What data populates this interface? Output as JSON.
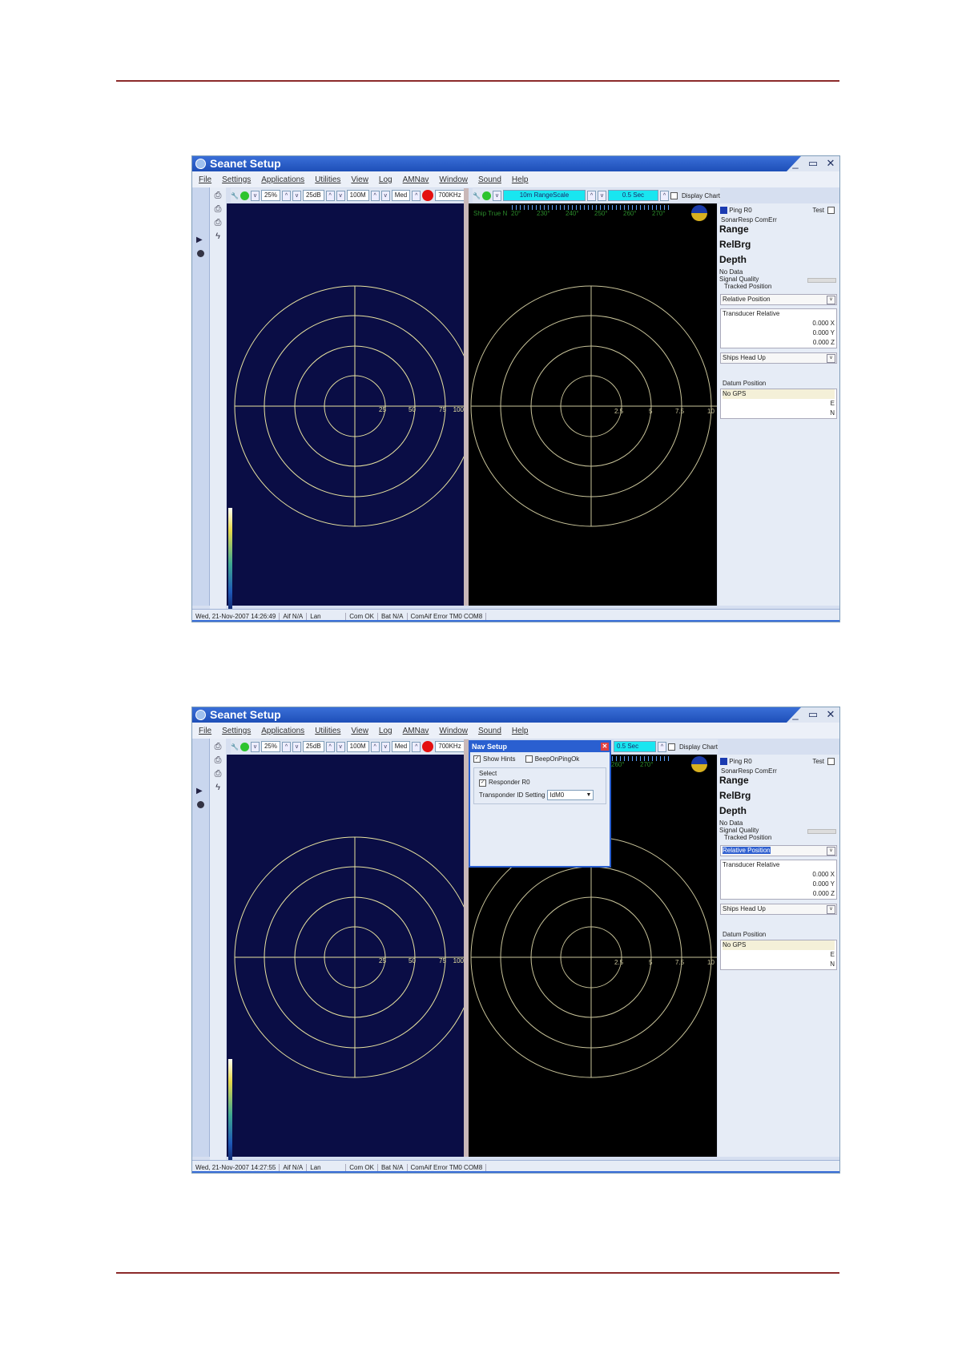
{
  "app_title": "Seanet Setup",
  "menu": [
    "File",
    "Settings",
    "Applications",
    "Utilities",
    "View",
    "Log",
    "AMNav",
    "Window",
    "Sound",
    "Help"
  ],
  "window_controls": [
    "_",
    "▭",
    "✕"
  ],
  "left_toolbar": {
    "gain_pct": "25%",
    "contrast": "25dB",
    "range": "100M",
    "resolution": "Med",
    "frequency": "700KHz"
  },
  "right_toolbar": {
    "range_scale": "10m RangeScale",
    "interval": "0.5 Sec",
    "display_chart": "Display Chart"
  },
  "heading_bar": {
    "label": "Ship True N",
    "bearings": [
      "20°",
      "230°",
      "240°",
      "250°",
      "260°",
      "270°"
    ]
  },
  "left_ring_labels": [
    "25",
    "50",
    "75",
    "100"
  ],
  "right_ring_labels": [
    "2.5",
    "5",
    "7.5",
    "10"
  ],
  "side": {
    "ping": "Ping R0",
    "test": "Test",
    "sonar_resp": "SonarResp ComErr",
    "range": "Range",
    "relbrg": "RelBrg",
    "depth": "Depth",
    "no_data": "No Data",
    "signal_quality": "Signal Quality",
    "tracked_position": "Tracked Position",
    "relative_position": "Relative Position",
    "transducer_relative": "Transducer Relative",
    "x": "0.000 X",
    "y": "0.000 Y",
    "z": "0.000 Z",
    "ships_head_up": "Ships Head Up",
    "datum_position": "Datum Position",
    "no_gps": "No GPS",
    "e": "E",
    "n": "N"
  },
  "nav_setup": {
    "title": "Nav Setup",
    "show_hints": "Show Hints",
    "beep": "BeepOnPingOk",
    "select": "Select",
    "responder": "Responder R0",
    "transponder_label": "Transponder ID Setting",
    "transponder_value": "IdM0"
  },
  "status1": {
    "datetime": "Wed, 21-Nov-2007 14:26:49",
    "aif": "Aif N/A",
    "lan": "Lan",
    "com": "Com OK",
    "bat": "Bat N/A",
    "comaif": "ComAif Error TM0 COM8"
  },
  "status2": {
    "datetime": "Wed, 21-Nov-2007 14:27:55",
    "aif": "Aif N/A",
    "lan": "Lan",
    "com": "Com OK",
    "bat": "Bat N/A",
    "comaif": "ComAif Error TM0 COM8"
  },
  "colors": {
    "rule": "#8c2a2a",
    "title": "#1e4fb8",
    "sonar_left": "#0a0d45",
    "sonar_right": "#000000",
    "rings": "#e8e3a0"
  }
}
